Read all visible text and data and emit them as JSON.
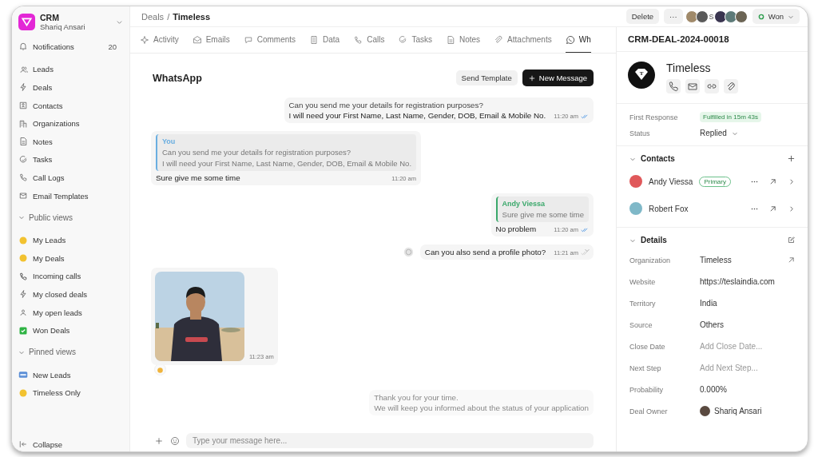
{
  "workspace": {
    "name": "CRM",
    "user": "Shariq Ansari"
  },
  "notifications": {
    "label": "Notifications",
    "count": "20"
  },
  "nav": [
    "Leads",
    "Deals",
    "Contacts",
    "Organizations",
    "Notes",
    "Tasks",
    "Call Logs",
    "Email Templates"
  ],
  "public_views": {
    "title": "Public views",
    "expanded": true,
    "items": [
      {
        "label": "My Leads",
        "kind": "emoji",
        "color": "#f2c230"
      },
      {
        "label": "My Deals",
        "kind": "emoji",
        "color": "#f2c230"
      },
      {
        "label": "Incoming calls",
        "kind": "phone"
      },
      {
        "label": "My closed deals",
        "kind": "bolt"
      },
      {
        "label": "My open leads",
        "kind": "people"
      },
      {
        "label": "Won Deals",
        "kind": "check"
      }
    ]
  },
  "pinned_views": {
    "title": "Pinned views",
    "expanded": true,
    "items": [
      {
        "label": "New Leads",
        "kind": "new"
      },
      {
        "label": "Timeless Only",
        "kind": "emoji",
        "color": "#f2c230"
      }
    ]
  },
  "collapse": "Collapse",
  "breadcrumb": {
    "parent": "Deals",
    "separator": "/",
    "current": "Timeless"
  },
  "actions": {
    "delete": "Delete",
    "more": "···",
    "avatars": [
      {
        "kind": "picture",
        "color": "#a08a6a"
      },
      {
        "kind": "picture",
        "color": "#5a5a5a"
      },
      {
        "kind": "initial",
        "initial": "S"
      },
      {
        "kind": "picture",
        "color": "#3a3550"
      },
      {
        "kind": "picture",
        "color": "#5d7a78"
      },
      {
        "kind": "picture",
        "color": "#6b6454"
      }
    ],
    "status": "Won"
  },
  "tabs": [
    {
      "label": "Activity",
      "selected": false
    },
    {
      "label": "Emails",
      "selected": false
    },
    {
      "label": "Comments",
      "selected": false
    },
    {
      "label": "Data",
      "selected": false
    },
    {
      "label": "Calls",
      "selected": false
    },
    {
      "label": "Tasks",
      "selected": false
    },
    {
      "label": "Notes",
      "selected": false
    },
    {
      "label": "Attachments",
      "selected": false
    },
    {
      "label": "Wh",
      "selected": true
    }
  ],
  "whatsapp": {
    "title": "WhatsApp",
    "send_template": "Send Template",
    "new_message": "New Message",
    "messages": [
      {
        "outgoing": true,
        "kind": "text",
        "lines": [
          "Can you send me your details for registration purposes?",
          "I will need your First Name, Last Name, Gender, DOB, Email & Mobile No."
        ],
        "time": "11:20 am",
        "read": true
      },
      {
        "outgoing": false,
        "kind": "text",
        "quote": {
          "author": "You",
          "color": "#6aaee0",
          "lines": [
            "Can you send me your details for registration purposes?",
            "I will need your First Name, Last Name, Gender, DOB, Email & Mobile No."
          ]
        },
        "lines": [
          "Sure give me some time"
        ],
        "time": "11:20 am"
      },
      {
        "outgoing": true,
        "kind": "text",
        "quote": {
          "author": "Andy Viessa",
          "color": "#3aa86b",
          "lines": [
            "Sure give me some time"
          ]
        },
        "lines": [
          "No problem"
        ],
        "time": "11:20 am",
        "read": true
      },
      {
        "outgoing": true,
        "kind": "text",
        "lines": [
          "Can you also send a profile photo?"
        ],
        "time": "11:21 am",
        "read": false,
        "menu": true
      },
      {
        "outgoing": false,
        "time": "11:23 am",
        "reaction": true
      },
      {
        "outgoing": true,
        "kind": "text",
        "lines": [
          "Thank you for your time.",
          "We will keep you informed about the status of your application"
        ]
      }
    ],
    "input": {
      "placeholder": "Type your message here..."
    }
  },
  "deal": {
    "id": "CRM-DEAL-2024-00018",
    "name": "Timeless",
    "logo_letter": "T",
    "first_response": {
      "label": "First Response",
      "value": "Fulfilled in 15m 43s"
    },
    "status": {
      "label": "Status",
      "value": "Replied"
    },
    "contacts": {
      "title": "Contacts",
      "expanded": true,
      "items": [
        {
          "name": "Andy Viessa",
          "badge": "Primary",
          "color": "#e0585a"
        },
        {
          "name": "Robert Fox",
          "color": "#7fb8c8"
        }
      ]
    },
    "details": {
      "title": "Details",
      "expanded": true,
      "rows": [
        {
          "label": "Organization",
          "value": "Timeless",
          "link": true
        },
        {
          "label": "Website",
          "value": "https://teslaindia.com"
        },
        {
          "label": "Territory",
          "value": "India"
        },
        {
          "label": "Source",
          "value": "Others"
        },
        {
          "label": "Close Date",
          "placeholder": "Add Close Date..."
        },
        {
          "label": "Next Step",
          "placeholder": "Add Next Step..."
        },
        {
          "label": "Probability",
          "value": "0.000%"
        },
        {
          "label": "Deal Owner",
          "value": "Shariq Ansari",
          "avatar": true
        }
      ]
    }
  }
}
